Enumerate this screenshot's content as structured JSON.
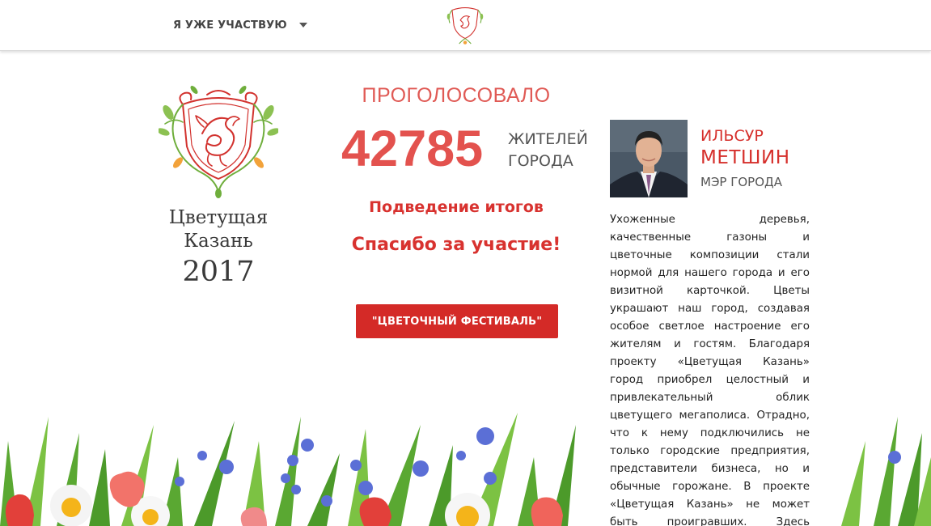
{
  "header": {
    "menu_label": "Я УЖЕ УЧАСТВУЮ",
    "logo_icon": "kazan-flower-emblem-icon"
  },
  "brand": {
    "title_line1": "Цветущая",
    "title_line2": "Казань",
    "year": "2017"
  },
  "counter": {
    "heading": "ПРОГОЛОСОВАЛО",
    "value": "42785",
    "unit_line1": "ЖИТЕЛЕЙ",
    "unit_line2": "ГОРОДА",
    "results": "Подведение итогов",
    "thanks": "Спасибо за участие!",
    "button": "\"ЦВЕТОЧНЫЙ ФЕСТИВАЛЬ\""
  },
  "mayor": {
    "first_name": "ИЛЬСУР",
    "last_name": "МЕТШИН",
    "role": "МЭР ГОРОДА",
    "text": "Ухоженные деревья, качественные газоны и цветочные композиции стали нормой для нашего города и его визитной карточкой. Цветы украшают наш город, создавая особое светлое настроение его жителям и гостям. Благодаря проекту «Цветущая Казань» город приобрел целостный и привлекательный облик цветущего мегаполиса. Отрадно, что к нему подключились не только городские предприятия, представители бизнеса, но и обычные горожане. В проекте «Цветущая Казань» не может быть проигравших. Здесь победителями будем мы все."
  },
  "colors": {
    "accent": "#d42a27",
    "number": "#e3524e",
    "emblem_red": "#d2322e",
    "emblem_green": "#6fae3c"
  }
}
